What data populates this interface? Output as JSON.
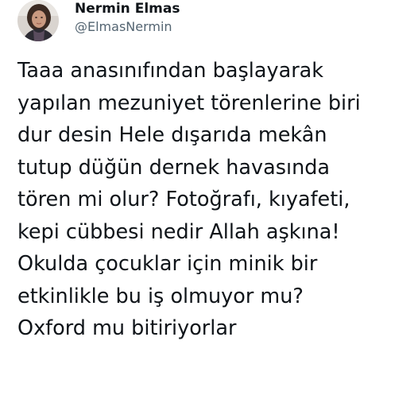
{
  "author": {
    "display_name": "Nermin Elmas",
    "handle": "@ElmasNermin",
    "avatar_icon": "profile-photo"
  },
  "tweet": {
    "lines": [
      "Taaa anasınıfından başlayarak",
      "yapılan mezuniyet törenlerine biri",
      "dur desin Hele dışarıda mekân",
      "tutup düğün dernek havasında",
      "tören mi olur? Fotoğrafı, kıyafeti,",
      "kepi cübbesi nedir Allah aşkına!",
      "Okulda çocuklar için minik bir",
      "etkinlikle bu iş olmuyor mu?",
      "Oxford mu bitiriyorlar"
    ]
  },
  "colors": {
    "text": "#0f1419",
    "secondary_text": "#536471",
    "background": "#ffffff"
  }
}
